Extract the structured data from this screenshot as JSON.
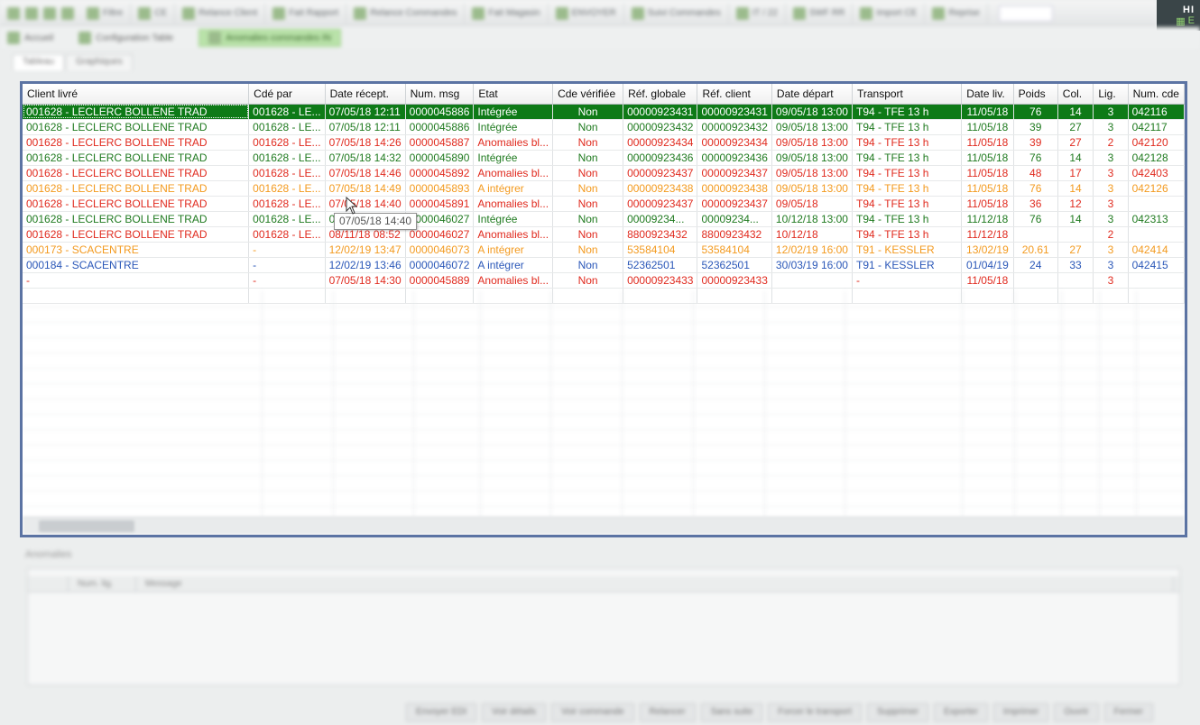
{
  "corner_badge": {
    "text": "HI",
    "sub": "E"
  },
  "toolbar": {
    "groups": [
      "Filtre",
      "CE",
      "Relance Client",
      "Fait Rapport",
      "Relance Commandes",
      "Fait Magasin",
      "ENVOYER",
      "Suivi Commandes",
      "IT / 22",
      "SWF RR",
      "Import CE",
      "Reprise"
    ]
  },
  "toolbar2": {
    "buttons": [
      "Accueil",
      "Configuration Table",
      "Anomalies commandes IN"
    ]
  },
  "tabs": [
    "Tableau",
    "Graphiques"
  ],
  "grid": {
    "columns": [
      "Client livré",
      "Cdé par",
      "Date récept.",
      "Num. msg",
      "Etat",
      "Cde vérifiée",
      "Réf. globale",
      "Réf. client",
      "Date départ",
      "Transport",
      "Date liv.",
      "Poids",
      "Col.",
      "Lig.",
      "Num. cde"
    ],
    "rows": [
      {
        "status": "green",
        "selected": true,
        "cells": [
          "001628 - LECLERC BOLLENE TRAD",
          "001628 - LE...",
          "07/05/18 12:11",
          "0000045886",
          "Intégrée",
          "Non",
          "00000923431",
          "00000923431",
          "09/05/18 13:00",
          "T94 - TFE 13 h",
          "11/05/18",
          "76",
          "14",
          "3",
          "042116"
        ]
      },
      {
        "status": "green",
        "selected": false,
        "cells": [
          "001628 - LECLERC BOLLENE TRAD",
          "001628 - LE...",
          "07/05/18 12:11",
          "0000045886",
          "Intégrée",
          "Non",
          "00000923432",
          "00000923432",
          "09/05/18 13:00",
          "T94 - TFE 13 h",
          "11/05/18",
          "39",
          "27",
          "3",
          "042117"
        ]
      },
      {
        "status": "red",
        "selected": false,
        "cells": [
          "001628 - LECLERC BOLLENE TRAD",
          "001628 - LE...",
          "07/05/18 14:26",
          "0000045887",
          "Anomalies bl...",
          "Non",
          "00000923434",
          "00000923434",
          "09/05/18 13:00",
          "T94 - TFE 13 h",
          "11/05/18",
          "39",
          "27",
          "2",
          "042120"
        ]
      },
      {
        "status": "green",
        "selected": false,
        "cells": [
          "001628 - LECLERC BOLLENE TRAD",
          "001628 - LE...",
          "07/05/18 14:32",
          "0000045890",
          "Intégrée",
          "Non",
          "00000923436",
          "00000923436",
          "09/05/18 13:00",
          "T94 - TFE 13 h",
          "11/05/18",
          "76",
          "14",
          "3",
          "042128"
        ]
      },
      {
        "status": "red",
        "selected": false,
        "cells": [
          "001628 - LECLERC BOLLENE TRAD",
          "001628 - LE...",
          "07/05/18 14:46",
          "0000045892",
          "Anomalies bl...",
          "Non",
          "00000923437",
          "00000923437",
          "09/05/18 13:00",
          "T94 - TFE 13 h",
          "11/05/18",
          "48",
          "17",
          "3",
          "042403"
        ]
      },
      {
        "status": "orange",
        "selected": false,
        "cells": [
          "001628 - LECLERC BOLLENE TRAD",
          "001628 - LE...",
          "07/05/18 14:49",
          "0000045893",
          "A intégrer",
          "Non",
          "00000923438",
          "00000923438",
          "09/05/18 13:00",
          "T94 - TFE 13 h",
          "11/05/18",
          "76",
          "14",
          "3",
          "042126"
        ]
      },
      {
        "status": "red",
        "selected": false,
        "cells": [
          "001628 - LECLERC BOLLENE TRAD",
          "001628 - LE...",
          "07/05/18 14:40",
          "0000045891",
          "Anomalies bl...",
          "Non",
          "00000923437",
          "00000923437",
          "09/05/18",
          "T94 - TFE 13 h",
          "11/05/18",
          "36",
          "12",
          "3",
          ""
        ]
      },
      {
        "status": "green",
        "selected": false,
        "cells": [
          "001628 - LECLERC BOLLENE TRAD",
          "001628 - LE...",
          "07/05/18 14:40",
          "0000046027",
          "Intégrée",
          "Non",
          "00009234...",
          "00009234...",
          "10/12/18 13:00",
          "T94 - TFE 13 h",
          "11/12/18",
          "76",
          "14",
          "3",
          "042313"
        ]
      },
      {
        "status": "red",
        "selected": false,
        "cells": [
          "001628 - LECLERC BOLLENE TRAD",
          "001628 - LE...",
          "08/11/18 08:52",
          "0000046027",
          "Anomalies bl...",
          "Non",
          "8800923432",
          "8800923432",
          "10/12/18",
          "T94 - TFE 13 h",
          "11/12/18",
          "",
          "",
          "2",
          ""
        ]
      },
      {
        "status": "orange",
        "selected": false,
        "cells": [
          "000173 - SCACENTRE",
          "-",
          "12/02/19 13:47",
          "0000046073",
          "A intégrer",
          "Non",
          "53584104",
          "53584104",
          "12/02/19 16:00",
          "T91 - KESSLER",
          "13/02/19",
          "20.61",
          "27",
          "3",
          "042414"
        ]
      },
      {
        "status": "blue",
        "selected": false,
        "cells": [
          "000184 - SCACENTRE",
          "-",
          "12/02/19 13:46",
          "0000046072",
          "A intégrer",
          "Non",
          "52362501",
          "52362501",
          "30/03/19 16:00",
          "T91 - KESSLER",
          "01/04/19",
          "24",
          "33",
          "3",
          "042415"
        ]
      },
      {
        "status": "red",
        "selected": false,
        "cells": [
          "-",
          "-",
          "07/05/18 14:30",
          "0000045889",
          "Anomalies bl...",
          "Non",
          "00000923433",
          "00000923433",
          "",
          "-",
          "11/05/18",
          "",
          "",
          "3",
          ""
        ]
      }
    ]
  },
  "tooltip": {
    "text": "07/05/18 14:40"
  },
  "anomalies": {
    "title": "Anomalies",
    "columns": [
      "",
      "Num. lig.",
      "Message"
    ]
  },
  "bottom_buttons": [
    "Envoyer EDI",
    "Voir détails",
    "Voir commande",
    "Relancer",
    "Sans suite",
    "Forcer le transport",
    "Supprimer",
    "Exporter",
    "Imprimer",
    "Ouvrir",
    "Fermer"
  ]
}
